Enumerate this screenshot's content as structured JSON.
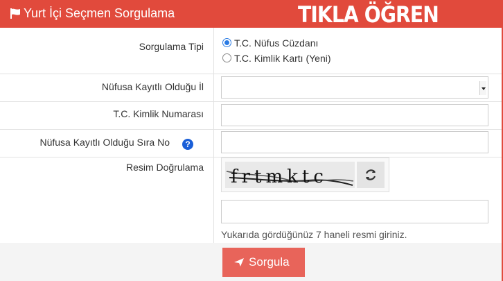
{
  "header": {
    "title": "Yurt İçi Seçmen Sorgulama",
    "promo": "TIKLA ÖĞREN",
    "flag_icon": "flag-icon",
    "color": "#e14a3c"
  },
  "form": {
    "query_type_label": "Sorgulama Tipi",
    "options": [
      "T.C. Nüfus Cüzdanı",
      "T.C. Kimlik Kartı (Yeni)"
    ],
    "selected_option": "T.C. Nüfus Cüzdanı",
    "province_label": "Nüfusa Kayıtlı Olduğu İl",
    "province_value": "",
    "tc_label": "T.C. Kimlik Numarası",
    "tc_value": "",
    "sira_label": "Nüfusa Kayıtlı Olduğu Sıra No",
    "help_icon": "question-circle-icon",
    "captcha_label": "Resim Doğrulama",
    "captcha_text": "frtmktc",
    "refresh_icon": "refresh-icon",
    "captcha_value": "",
    "hint": "Yukarıda gördüğünüz 7 haneli resmi giriniz.",
    "submit_label": "Sorgula",
    "submit_icon": "send-icon",
    "submit_color": "#e8645a"
  }
}
